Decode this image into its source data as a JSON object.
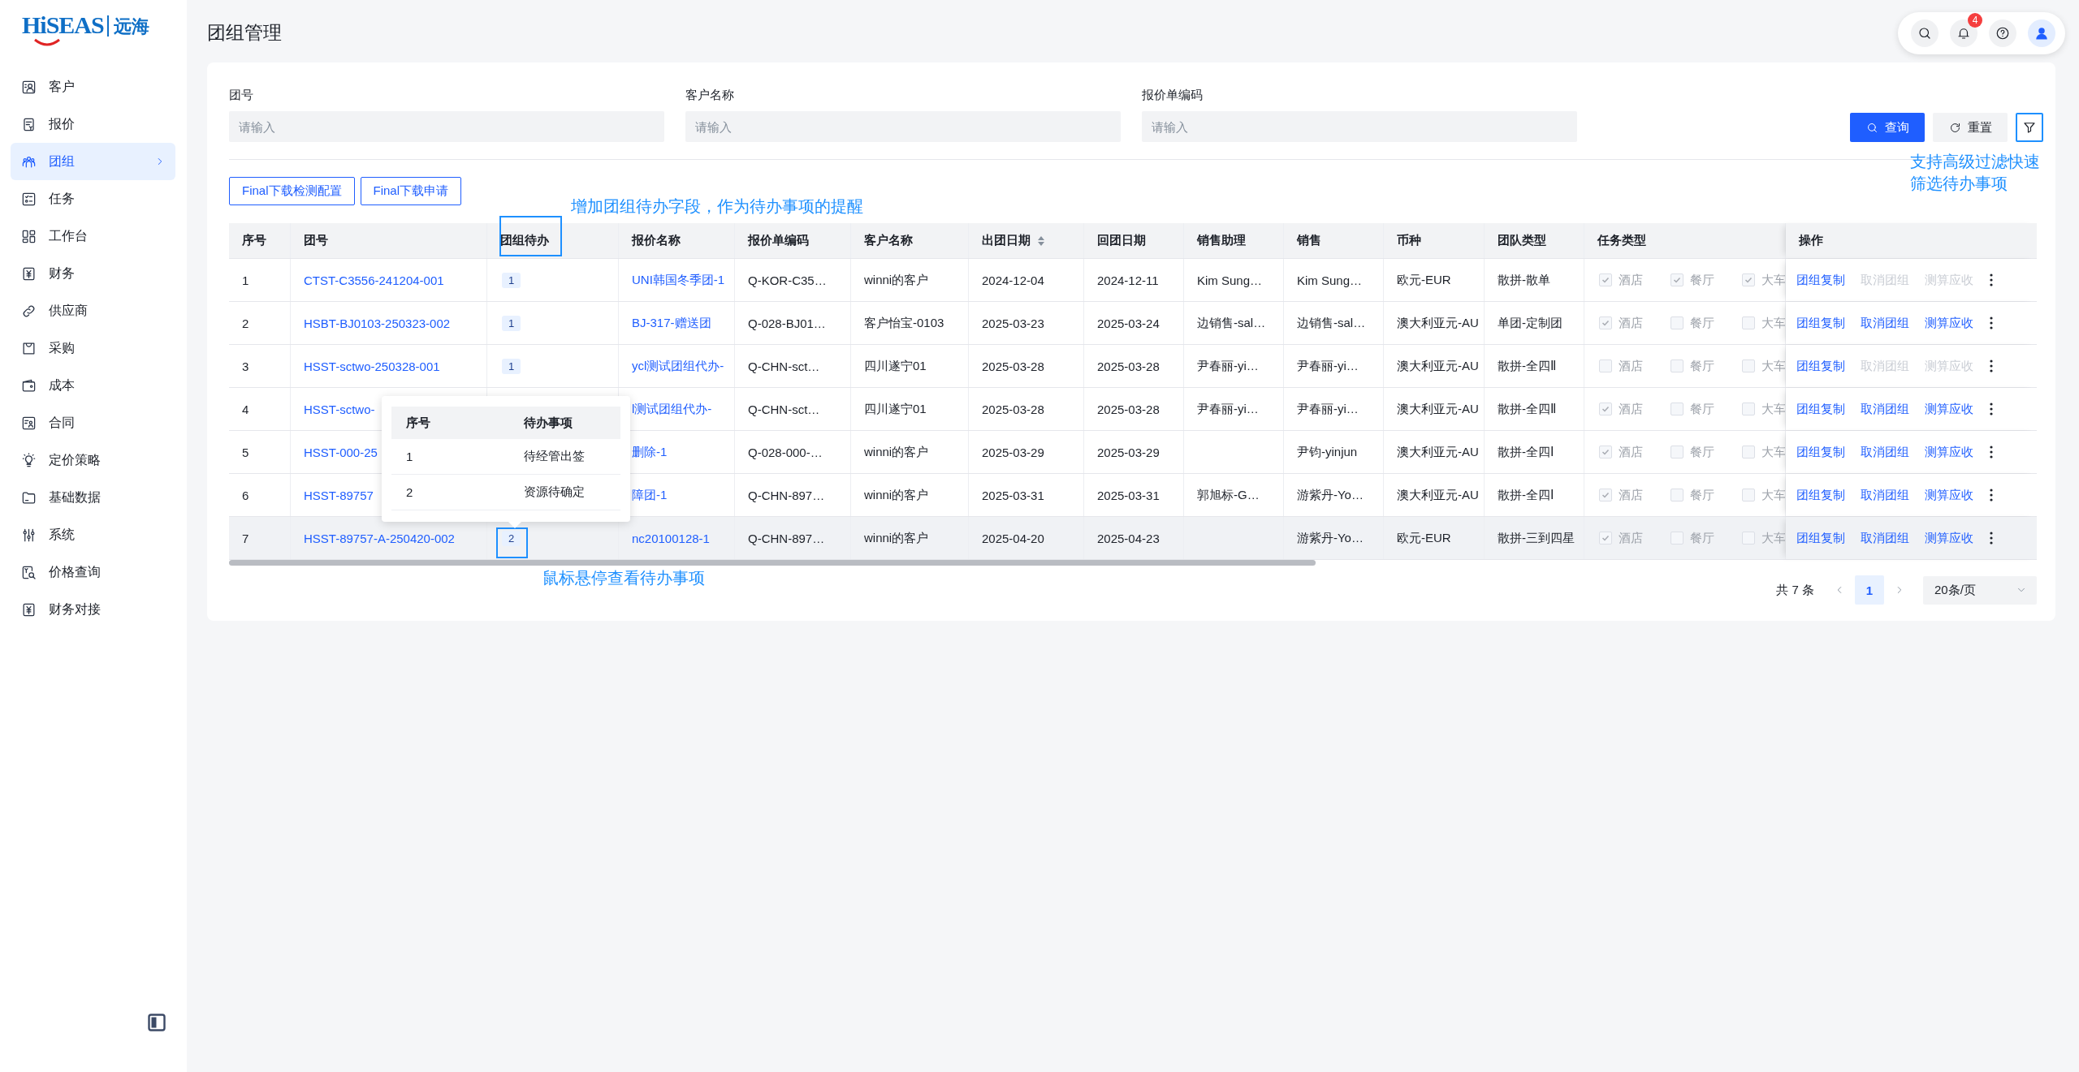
{
  "sidebar": {
    "logo": {
      "brand": "HiSEAS",
      "name": "远海"
    },
    "items": [
      {
        "label": "客户",
        "selected": false
      },
      {
        "label": "报价",
        "selected": false
      },
      {
        "label": "团组",
        "selected": true
      },
      {
        "label": "任务",
        "selected": false
      },
      {
        "label": "工作台",
        "selected": false
      },
      {
        "label": "财务",
        "selected": false
      },
      {
        "label": "供应商",
        "selected": false
      },
      {
        "label": "采购",
        "selected": false
      },
      {
        "label": "成本",
        "selected": false
      },
      {
        "label": "合同",
        "selected": false
      },
      {
        "label": "定价策略",
        "selected": false
      },
      {
        "label": "基础数据",
        "selected": false
      },
      {
        "label": "系统",
        "selected": false
      },
      {
        "label": "价格查询",
        "selected": false
      },
      {
        "label": "财务对接",
        "selected": false
      }
    ]
  },
  "header": {
    "title": "团组管理",
    "notification_count": "4"
  },
  "filters": {
    "fields": [
      {
        "label": "团号",
        "placeholder": "请输入"
      },
      {
        "label": "客户名称",
        "placeholder": "请输入"
      },
      {
        "label": "报价单编码",
        "placeholder": "请输入"
      }
    ],
    "buttons": [
      {
        "label": "查询",
        "kind": "primary"
      },
      {
        "label": "重置",
        "kind": "secondary"
      }
    ]
  },
  "toolbar": [
    "Final下载检测配置",
    "Final下载申请"
  ],
  "table": {
    "columns": [
      {
        "label": "序号",
        "sortable": false
      },
      {
        "label": "团号",
        "sortable": false
      },
      {
        "label": "团组待办",
        "sortable": false
      },
      {
        "label": "报价名称",
        "sortable": false
      },
      {
        "label": "报价单编码",
        "sortable": false
      },
      {
        "label": "客户名称",
        "sortable": false
      },
      {
        "label": "出团日期",
        "sortable": true
      },
      {
        "label": "回团日期",
        "sortable": false
      },
      {
        "label": "销售助理",
        "sortable": false
      },
      {
        "label": "销售",
        "sortable": false
      },
      {
        "label": "币种",
        "sortable": false
      },
      {
        "label": "团队类型",
        "sortable": false
      },
      {
        "label": "任务类型",
        "sortable": false
      },
      {
        "label": "操作",
        "sortable": false
      }
    ],
    "rows": [
      {
        "index": "1",
        "group_no": "CTST-C3556-241204-001",
        "todo": "1",
        "quote_name": "UNI韩国冬季团-1",
        "quote_code": "Q-KOR-C35…",
        "customer": "winni的客户",
        "depart_date": "2024-12-04",
        "return_date": "2024-12-11",
        "sales_assistant": "Kim Sung…",
        "sales": "Kim Sung…",
        "currency": "欧元-EUR",
        "team_type": "散拼-散单",
        "hovered": false,
        "tasks": [
          {
            "label": "酒店",
            "checked": true,
            "disabled": true
          },
          {
            "label": "餐厅",
            "checked": true,
            "disabled": true
          },
          {
            "label": "大车",
            "checked": true,
            "disabled": true
          }
        ],
        "actions": [
          {
            "label": "团组复制",
            "disabled": false
          },
          {
            "label": "取消团组",
            "disabled": true
          },
          {
            "label": "测算应收",
            "disabled": true
          }
        ]
      },
      {
        "index": "2",
        "group_no": "HSBT-BJ0103-250323-002",
        "todo": "1",
        "quote_name": "BJ-317-赠送团",
        "quote_code": "Q-028-BJ01…",
        "customer": "客户怡宝-0103",
        "depart_date": "2025-03-23",
        "return_date": "2025-03-24",
        "sales_assistant": "边销售-sal…",
        "sales": "边销售-sal…",
        "currency": "澳大利亚元-AU",
        "team_type": "单团-定制团",
        "hovered": false,
        "tasks": [
          {
            "label": "酒店",
            "checked": true,
            "disabled": true
          },
          {
            "label": "餐厅",
            "checked": false,
            "disabled": true
          },
          {
            "label": "大车",
            "checked": false,
            "disabled": true
          }
        ],
        "actions": [
          {
            "label": "团组复制",
            "disabled": false
          },
          {
            "label": "取消团组",
            "disabled": false
          },
          {
            "label": "测算应收",
            "disabled": false
          }
        ]
      },
      {
        "index": "3",
        "group_no": "HSST-sctwo-250328-001",
        "todo": "1",
        "quote_name": "ycl测试团组代办-",
        "quote_code": "Q-CHN-sct…",
        "customer": "四川遂宁01",
        "depart_date": "2025-03-28",
        "return_date": "2025-03-28",
        "sales_assistant": "尹春丽-yi…",
        "sales": "尹春丽-yi…",
        "currency": "澳大利亚元-AU",
        "team_type": "散拼-全四Ⅱ",
        "hovered": false,
        "tasks": [
          {
            "label": "酒店",
            "checked": false,
            "disabled": true
          },
          {
            "label": "餐厅",
            "checked": false,
            "disabled": true
          },
          {
            "label": "大车",
            "checked": false,
            "disabled": true
          }
        ],
        "actions": [
          {
            "label": "团组复制",
            "disabled": false
          },
          {
            "label": "取消团组",
            "disabled": true
          },
          {
            "label": "测算应收",
            "disabled": true
          }
        ]
      },
      {
        "index": "4",
        "group_no": "HSST-sctwo-",
        "quote_name": "l测试团组代办-",
        "quote_code": "Q-CHN-sct…",
        "customer": "四川遂宁01",
        "depart_date": "2025-03-28",
        "return_date": "2025-03-28",
        "sales_assistant": "尹春丽-yi…",
        "sales": "尹春丽-yi…",
        "currency": "澳大利亚元-AU",
        "team_type": "散拼-全四Ⅱ",
        "hovered": false,
        "tasks": [
          {
            "label": "酒店",
            "checked": true,
            "disabled": true
          },
          {
            "label": "餐厅",
            "checked": false,
            "disabled": true
          },
          {
            "label": "大车",
            "checked": false,
            "disabled": true
          }
        ],
        "actions": [
          {
            "label": "团组复制",
            "disabled": false
          },
          {
            "label": "取消团组",
            "disabled": false
          },
          {
            "label": "测算应收",
            "disabled": false
          }
        ]
      },
      {
        "index": "5",
        "group_no": "HSST-000-25",
        "quote_name": "删除-1",
        "quote_code": "Q-028-000-…",
        "customer": "winni的客户",
        "depart_date": "2025-03-29",
        "return_date": "2025-03-29",
        "sales": "尹钧-yinjun",
        "currency": "澳大利亚元-AU",
        "team_type": "散拼-全四Ⅰ",
        "hovered": false,
        "tasks": [
          {
            "label": "酒店",
            "checked": true,
            "disabled": true
          },
          {
            "label": "餐厅",
            "checked": false,
            "disabled": true
          },
          {
            "label": "大车",
            "checked": false,
            "disabled": true
          }
        ],
        "actions": [
          {
            "label": "团组复制",
            "disabled": false
          },
          {
            "label": "取消团组",
            "disabled": false
          },
          {
            "label": "测算应收",
            "disabled": false
          }
        ]
      },
      {
        "index": "6",
        "group_no": "HSST-89757",
        "quote_name": "障团-1",
        "quote_code": "Q-CHN-897…",
        "customer": "winni的客户",
        "depart_date": "2025-03-31",
        "return_date": "2025-03-31",
        "sales_assistant": "郭旭标-G…",
        "sales": "游紫丹-Yo…",
        "currency": "澳大利亚元-AU",
        "team_type": "散拼-全四Ⅰ",
        "hovered": false,
        "tasks": [
          {
            "label": "酒店",
            "checked": true,
            "disabled": true
          },
          {
            "label": "餐厅",
            "checked": false,
            "disabled": true
          },
          {
            "label": "大车",
            "checked": false,
            "disabled": true
          }
        ],
        "actions": [
          {
            "label": "团组复制",
            "disabled": false
          },
          {
            "label": "取消团组",
            "disabled": false
          },
          {
            "label": "测算应收",
            "disabled": false
          }
        ]
      },
      {
        "index": "7",
        "group_no": "HSST-89757-A-250420-002",
        "todo": "2",
        "quote_name": "nc20100128-1",
        "quote_code": "Q-CHN-897…",
        "customer": "winni的客户",
        "depart_date": "2025-04-20",
        "return_date": "2025-04-23",
        "sales": "游紫丹-Yo…",
        "currency": "欧元-EUR",
        "team_type": "散拼-三到四星",
        "hovered": true,
        "tasks": [
          {
            "label": "酒店",
            "checked": true,
            "disabled": true
          },
          {
            "label": "餐厅",
            "checked": false,
            "disabled": true
          },
          {
            "label": "大车",
            "checked": false,
            "disabled": true
          }
        ],
        "actions": [
          {
            "label": "团组复制",
            "disabled": false
          },
          {
            "label": "取消团组",
            "disabled": false
          },
          {
            "label": "测算应收",
            "disabled": false
          }
        ]
      }
    ]
  },
  "popover": {
    "columns": [
      "序号",
      "待办事项"
    ],
    "rows": [
      [
        "1",
        "待经管出签"
      ],
      [
        "2",
        "资源待确定"
      ]
    ]
  },
  "pagination": {
    "total": "共 7 条",
    "pages": [
      {
        "label": "1",
        "selected": true
      }
    ],
    "page_size": "20条/页"
  },
  "annotations": [
    {
      "text": "增加团组待办字段，作为待办事项的提醒"
    },
    {
      "text": "支持高级过滤快速筛选待办事项"
    },
    {
      "text": "鼠标悬停查看待办事项"
    }
  ]
}
